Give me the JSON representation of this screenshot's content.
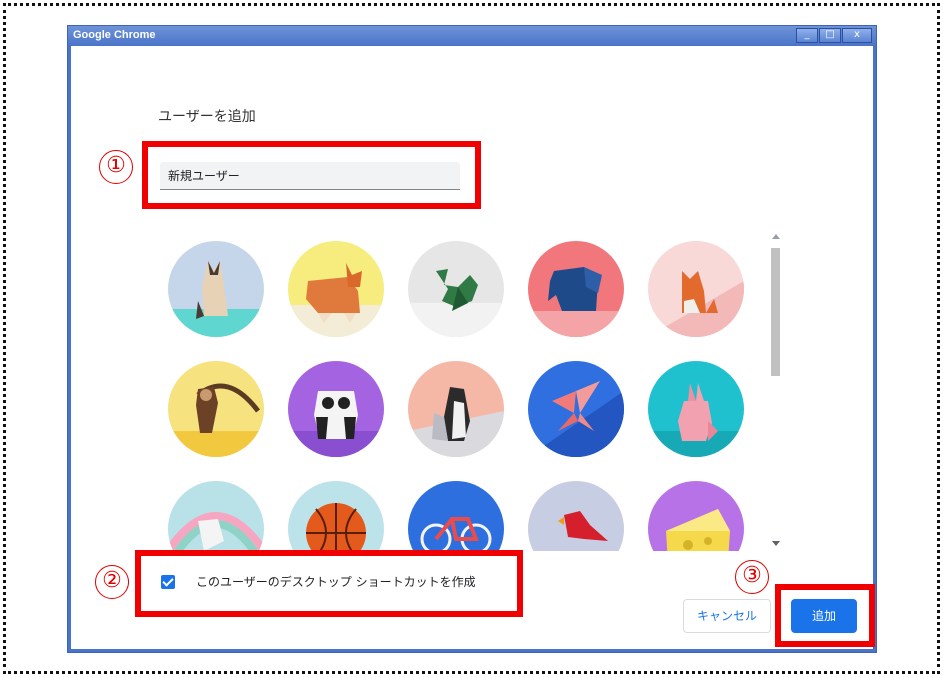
{
  "window": {
    "title": "Google Chrome",
    "controls": {
      "minimize": "_",
      "maximize": "□",
      "close": "x"
    }
  },
  "dialog": {
    "heading": "ユーザーを追加",
    "name_input": {
      "value": "新規ユーザー"
    },
    "avatars": [
      "siamese-cat",
      "corgi",
      "dragon",
      "elephant",
      "fox",
      "monkey",
      "panda",
      "penguin",
      "butterfly",
      "rabbit",
      "unicorn",
      "basketball",
      "bicycle",
      "bird",
      "cheese"
    ],
    "desktop_shortcut": {
      "label": "このユーザーのデスクトップ ショートカットを作成",
      "checked": true
    },
    "cancel_label": "キャンセル",
    "add_label": "追加"
  },
  "annotations": {
    "step1": "①",
    "step2": "②",
    "step3": "③"
  },
  "colors": {
    "accent": "#1a73e8",
    "highlight": "#f00000",
    "titlebar": "#4a74c8"
  }
}
